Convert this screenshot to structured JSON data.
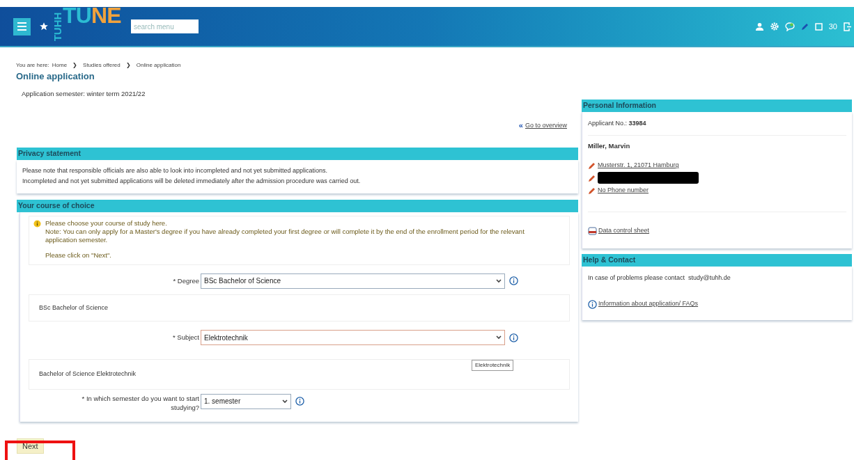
{
  "header": {
    "logo_vertical": "TUHH",
    "logo_part_1": "TU",
    "logo_part_2": "NE",
    "search_placeholder": "search menu",
    "counter": "30"
  },
  "breadcrumb": {
    "prefix": "You are here:",
    "items": [
      "Home",
      "Studies offered",
      "Online application"
    ],
    "separators": [
      "❯",
      "❯"
    ]
  },
  "page_title": "Online application",
  "semester_text": "Application semester: winter term 2021/22",
  "overview_link": {
    "icon": "«",
    "text": "Go to overview"
  },
  "privacy": {
    "title": "Privacy statement",
    "lines": [
      "Please note that responsible officials are also able to look into incompleted and not yet submitted applications.",
      "Incompleted and not yet submitted applications will be deleted immediately after the admission procedure was carried out."
    ]
  },
  "course": {
    "title": "Your course of choice",
    "notes": [
      "Please choose your course of study here.",
      "Note: You can only apply for a Master's degree if you have already completed your first degree or will complete it by the end of the enrollment period for the relevant application semester."
    ],
    "click_note": "Please click on \"Next\".",
    "degree": {
      "label": "* Degree",
      "value": "BSc Bachelor of Science",
      "caption": "BSc Bachelor of Science"
    },
    "subject": {
      "label": "* Subject",
      "value": "Elektrotechnik",
      "caption": "Bachelor of Science Elektrotechnik",
      "tooltip": "Elektrotechnik"
    },
    "semester": {
      "label": "* In which semester do you want to start studying?",
      "value": "1. semester"
    },
    "next_button": "Next"
  },
  "personal": {
    "title": "Personal Information",
    "applicant_label": "Applicant No.:",
    "applicant_no": "33984",
    "name": "Miller, Marvin",
    "contacts": [
      {
        "text": "Musterstr. 1, 21071 Hamburg",
        "redacted": false
      },
      {
        "redacted": true
      },
      {
        "text": "No Phone number",
        "redacted": false
      }
    ],
    "data_sheet": "Data control sheet"
  },
  "help": {
    "title": "Help & Contact",
    "text": "In case of problems please contact  study@tuhh.de",
    "faq": "Information about application/ FAQs"
  }
}
